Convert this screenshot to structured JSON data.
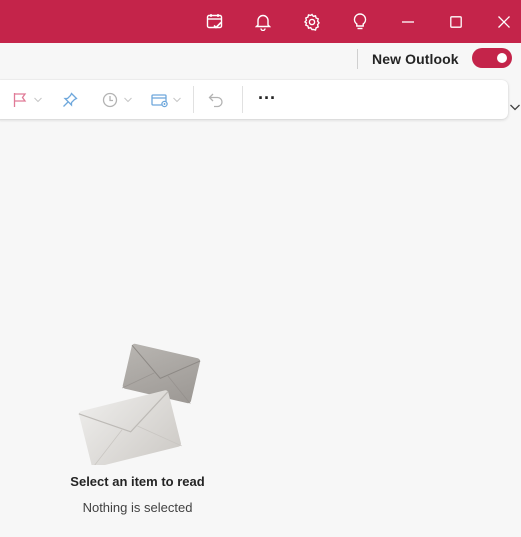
{
  "titlebar": {
    "background": "#c4244a",
    "icons": [
      "calendar-check-icon",
      "bell-icon",
      "gear-icon",
      "lightbulb-icon",
      "minimize-icon",
      "maximize-icon",
      "close-icon"
    ]
  },
  "new_outlook": {
    "label": "New Outlook",
    "toggle_on": true
  },
  "toolbar": {
    "items": [
      "flag-icon",
      "pin-icon",
      "clock-icon",
      "move-to-folder-icon",
      "undo-icon"
    ],
    "more_label": "···"
  },
  "reading_pane": {
    "title": "Select an item to read",
    "subtitle": "Nothing is selected"
  }
}
